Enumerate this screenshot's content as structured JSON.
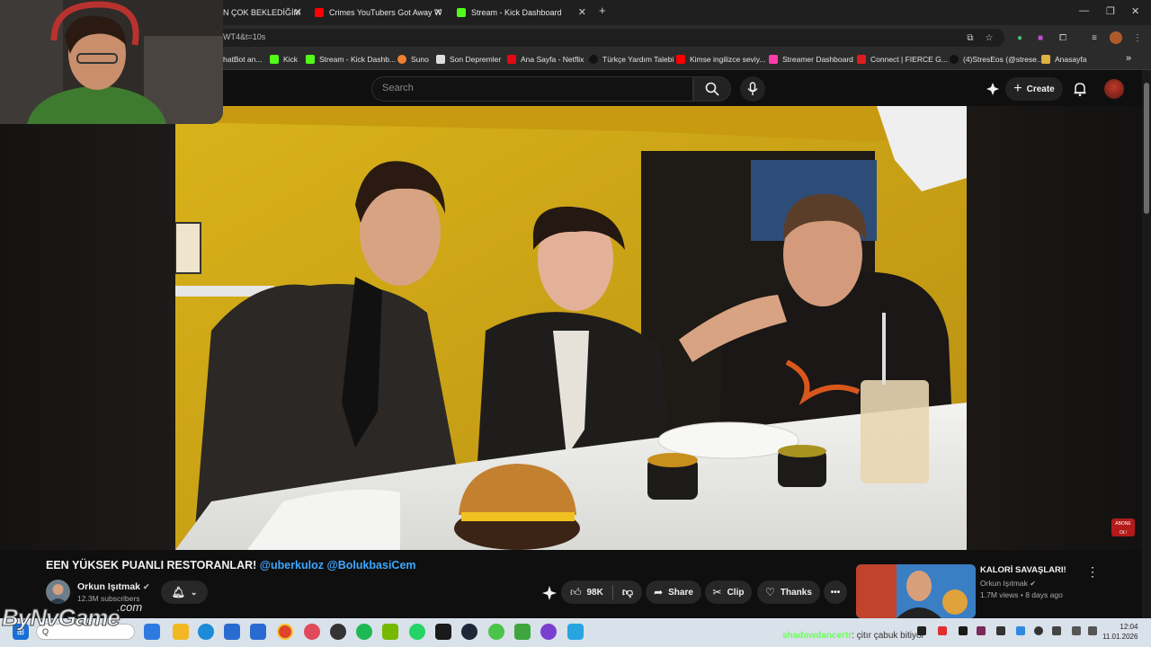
{
  "browser": {
    "tabs": [
      {
        "title": "N ÇOK BEKLEDİĞİM",
        "color": "#ff0000"
      },
      {
        "title": "Crimes YouTubers Got Away W",
        "color": "#ff0000"
      },
      {
        "title": "Stream - Kick Dashboard",
        "color": "#53fc18"
      }
    ],
    "new_tab": "+",
    "url": "WT4&t=10s",
    "bookmarks": [
      {
        "label": "hatBot an...",
        "color": "#888888"
      },
      {
        "label": "Kick",
        "color": "#53fc18"
      },
      {
        "label": "Stream - Kick Dashb...",
        "color": "#53fc18"
      },
      {
        "label": "Suno",
        "color": "#f08030"
      },
      {
        "label": "Son Depremler",
        "color": "#dddddd"
      },
      {
        "label": "Ana Sayfa - Netflix",
        "color": "#e50914"
      },
      {
        "label": "Türkçe Yardım Talebi",
        "color": "#111111"
      },
      {
        "label": "Kimse ingilizce seviy...",
        "color": "#ff0000"
      },
      {
        "label": "Streamer Dashboard",
        "color": "#ff3cac"
      },
      {
        "label": "Connect | FIERCE G...",
        "color": "#e01b1b"
      },
      {
        "label": "(4)StresEos (@strese...",
        "color": "#111111"
      },
      {
        "label": "Anasayfa",
        "color": "#e0b040"
      }
    ],
    "more": "»"
  },
  "youtube": {
    "search_placeholder": "Search",
    "create_label": "Create",
    "video": {
      "title_prefix": "EEN YÜKSEK PUANLI RESTORANLAR!",
      "mention1": "@uberkuloz",
      "mention2": "@BolukbasiCem",
      "channel_name": "Orkun Işıtmak",
      "subscribers": "12.3M subscribers",
      "likes": "98K",
      "share_label": "Share",
      "clip_label": "Clip",
      "thanks_label": "Thanks",
      "watermark_badge": "ABONE OL!"
    },
    "recommended": {
      "title": "KALORİ SAVAŞLARI!",
      "channel": "Orkun Işıtmak",
      "meta": "1.7M views • 8 days ago"
    }
  },
  "overlay": {
    "watermark": "ByNvGame",
    "watermark_suffix": ".com",
    "ticker_user": "shadowdancertr",
    "ticker_msg": ": çitır çabuk bitiyor"
  },
  "taskbar": {
    "time": "12:04",
    "date": "11.01.2026"
  }
}
